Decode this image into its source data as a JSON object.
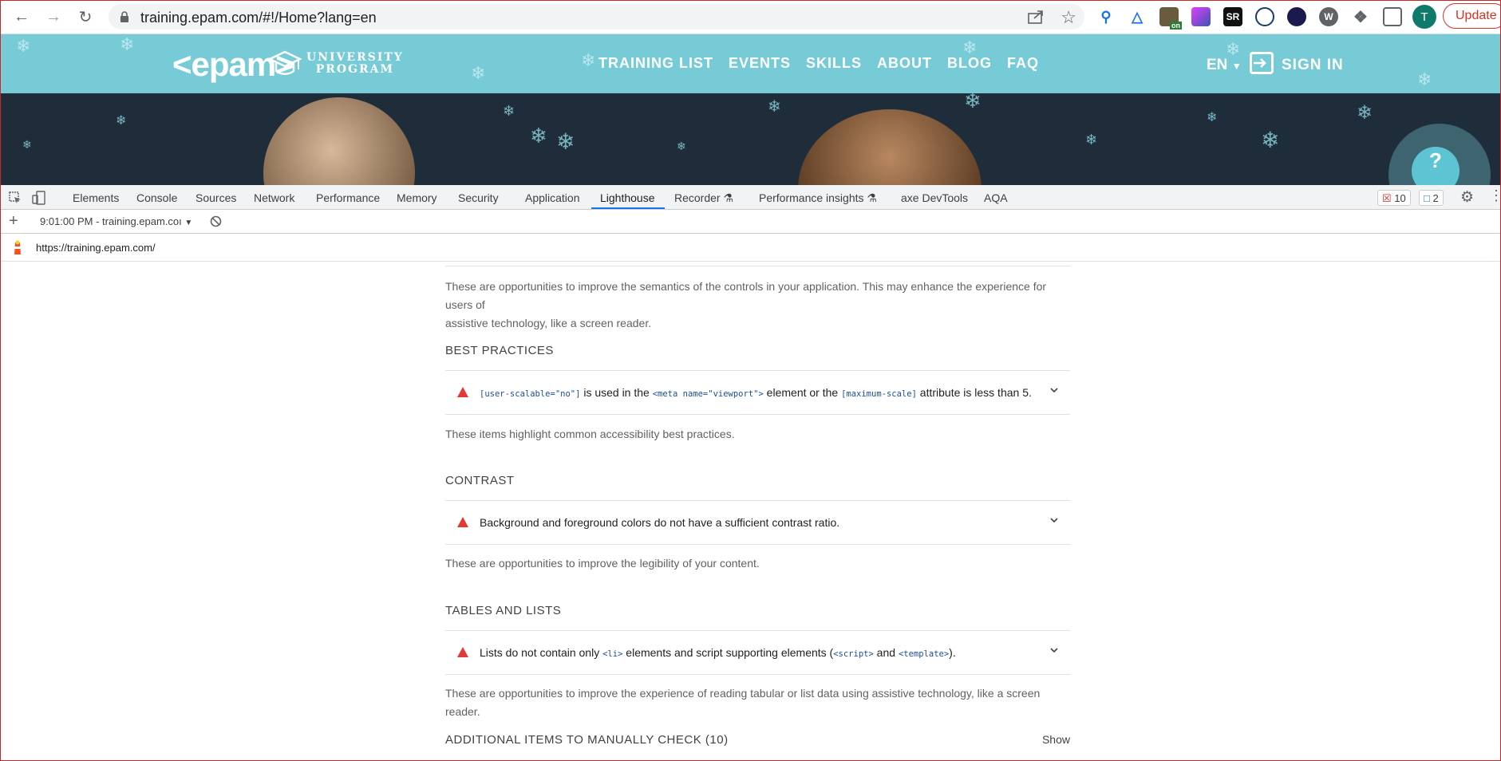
{
  "browser": {
    "url": "training.epam.com/#!/Home?lang=en",
    "avatar_letter": "T",
    "update_label": "Update",
    "extensions": [
      "zoom-search-icon",
      "triangle-extension-icon",
      "cow-extension-icon",
      "puzzle-app-icon",
      "sr-extension-icon",
      "wave-extension-icon",
      "dark-circle-extension-icon",
      "w-extension-icon",
      "puzzle-extensions-icon",
      "side-panel-icon"
    ],
    "ext_labels": {
      "sr": "SR",
      "w": "W",
      "on": "on"
    }
  },
  "site": {
    "logo": "<epam>",
    "program_line1": "UNIVERSITY",
    "program_line2": "PROGRAM",
    "nav": [
      "TRAINING LIST",
      "EVENTS",
      "SKILLS",
      "ABOUT",
      "BLOG",
      "FAQ"
    ],
    "lang": "EN",
    "sign_in": "SIGN IN",
    "help": "?",
    "brand_color": "#77cbd6"
  },
  "devtools": {
    "tabs": [
      "Elements",
      "Console",
      "Sources",
      "Network",
      "Performance",
      "Memory",
      "Security",
      "Application",
      "Lighthouse",
      "Recorder",
      "Performance insights",
      "axe DevTools",
      "AQA"
    ],
    "active_tab": "Lighthouse",
    "errors_count": "10",
    "messages_count": "2",
    "report_selector": "9:01:00 PM - training.epam.coı",
    "report_url": "https://training.epam.com/"
  },
  "report": {
    "aria_desc_line1": "These are opportunities to improve the semantics of the controls in your application. This may enhance the experience for users of",
    "aria_desc_line2": "assistive technology, like a screen reader.",
    "groups": [
      {
        "title": "BEST PRACTICES",
        "audit": {
          "code1": "[user-scalable=\"no\"]",
          "text1": " is used in the ",
          "code2": "<meta name=\"viewport\">",
          "text2": " element or the ",
          "code3": "[maximum-scale]",
          "text3": " attribute is less than 5."
        },
        "description": "These items highlight common accessibility best practices."
      },
      {
        "title": "CONTRAST",
        "audit": {
          "text1": "Background and foreground colors do not have a sufficient contrast ratio."
        },
        "description": "These are opportunities to improve the legibility of your content."
      },
      {
        "title": "TABLES AND LISTS",
        "audit": {
          "text1": "Lists do not contain only ",
          "code1": "<li>",
          "text2": " elements and script supporting elements (",
          "code2": "<script>",
          "text3": " and ",
          "code3": "<template>",
          "text4": ")."
        },
        "description": "These are opportunities to improve the experience of reading tabular or list data using assistive technology, like a screen reader."
      }
    ],
    "manual_title": "ADDITIONAL ITEMS TO MANUALLY CHECK (10)",
    "manual_toggle": "Show",
    "fail_color": "#e53935"
  }
}
